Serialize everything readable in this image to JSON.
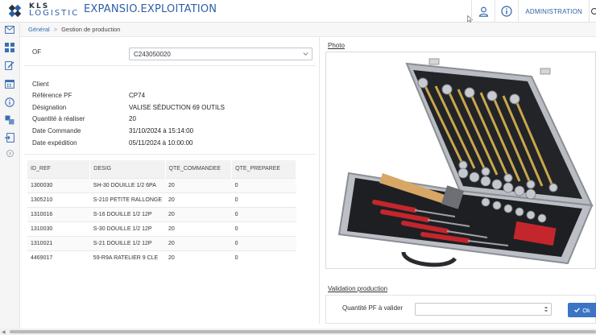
{
  "header": {
    "logo_top": "KLS",
    "logo_bottom": "LOGISTIC",
    "app_title": "EXPANSIO.EXPLOITATION",
    "user_icon": "user-icon",
    "info_icon": "info-icon",
    "admin_label": "ADMINISTRATION"
  },
  "sidebar": {
    "icons": [
      "mail-icon",
      "grid-icon",
      "edit-icon",
      "calendar-icon",
      "info-icon",
      "boxes-icon",
      "export-icon",
      "chevron-right-icon"
    ]
  },
  "breadcrumb": {
    "home": "Général",
    "separator": ">",
    "current": "Gestion de production"
  },
  "form": {
    "of_label": "OF",
    "of_value": "C243050020",
    "fields": [
      {
        "label": "Client",
        "value": ""
      },
      {
        "label": "Référence PF",
        "value": "CP74"
      },
      {
        "label": "Désignation",
        "value": "VALISE SÉDUCTION 69 OUTILS"
      },
      {
        "label": "Quantité à réaliser",
        "value": "20"
      },
      {
        "label": "Date Commande",
        "value": "31/10/2024 à 15:14:00"
      },
      {
        "label": "Date expédition",
        "value": "05/11/2024 à 10:00:00"
      }
    ]
  },
  "table": {
    "columns": [
      "ID_REF",
      "DESIG",
      "QTE_COMMANDEE",
      "QTE_PREPAREE"
    ],
    "rows": [
      [
        "1300030",
        "SH-30 DOUILLE 1/2 6PA",
        "20",
        "0"
      ],
      [
        "1305210",
        "S-210 PETITE RALLONGE",
        "20",
        "0"
      ],
      [
        "1310016",
        "S-16 DOUILLE 1/2 12P",
        "20",
        "0"
      ],
      [
        "1310030",
        "S-30 DOUILLE 1/2 12P",
        "20",
        "0"
      ],
      [
        "1310021",
        "S-21 DOUILLE 1/2 12P",
        "20",
        "0"
      ],
      [
        "4469017",
        "59-R9A RATELIER 9 CLE",
        "20",
        "0"
      ]
    ]
  },
  "photo": {
    "title": "Photo"
  },
  "validation": {
    "title": "Validation production",
    "qty_label": "Quantité PF à valider",
    "qty_value": "",
    "ok_label": "Ok"
  },
  "colors": {
    "brand_blue": "#2b5fa8",
    "ok_button": "#3b74c4"
  }
}
